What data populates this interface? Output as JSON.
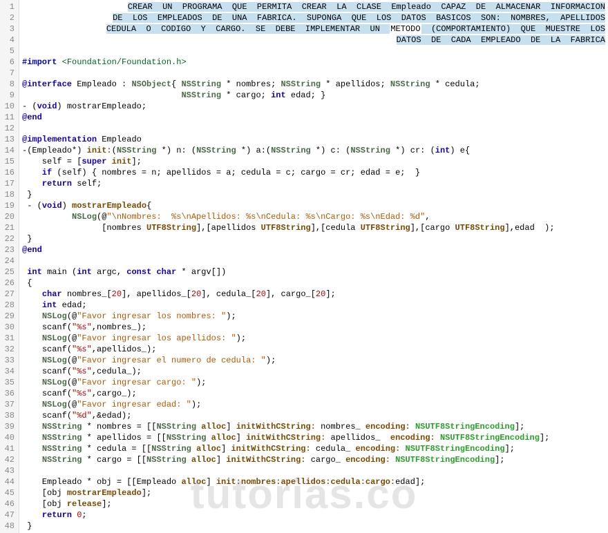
{
  "header": {
    "l1": "CREAR  UN  PROGRAMA  QUE  PERMITA  CREAR  LA  CLASE  Empleado  CAPAZ  DE  ALMACENAR  INFORMACION",
    "l2": "DE  LOS  EMPLEADOS  DE  UNA  FABRICA.  SUPONGA  QUE  LOS  DATOS  BASICOS  SON:  NOMBRES,  APELLIDOS",
    "l3_pre": "CEDULA  O  CODIGO  Y  CARGO.  SE  DEBE  IMPLEMENTAR  UN  ",
    "l3_word": "METODO",
    "l3_post": "  (COMPORTAMIENTO)  QUE  MUESTRE  LOS",
    "l4": "DATOS  DE  CADA  EMPLEADO  DE  LA  FABRICA"
  },
  "c": {
    "import": "#import",
    "incfile": "<Foundation/Foundation.h>",
    "interface": "@interface",
    "Empleado": " Empleado : ",
    "NSObject": "NSObject",
    "lb": "{ ",
    "NSString": "NSString",
    "star_nom": " * nombres; ",
    "star_ape": " * apellidos; ",
    "star_ced": " * cedula;",
    "star_car": " * cargo; ",
    "int": "int",
    "edad_cb": " edad; }",
    "dash": "- (",
    "void": "void",
    "mostrar_decl": ") mostrarEmpleado;",
    "atend": "@end",
    "impl": "@implementation",
    "imp_emp": " Empleado",
    "init_sig1": "-(Empleado*) ",
    "init": "init:",
    "p_n": "(",
    "ptrc": " *) ",
    "n_nm": "n",
    "colon": ": (",
    "a_nm": "a",
    "c_nm": "c",
    "cr_nm": "cr",
    "int_close": ") ",
    "e_ob": "e",
    "ob": "{",
    "self_super": "    self = [",
    "super": "super",
    "init_kw": " init",
    "rb_semi": "];",
    "if": "    if",
    "if_body": " (self) { nombres = n; apellidos = a; cedula = c; cargo = cr; edad = e;  }",
    "return": "    return",
    "self_semi": " self;",
    "rb": "}",
    "dash2": " - (",
    "mostrar_imp": ") ",
    "mostrarEmpleado": "mostrarEmpleado",
    "ob2": "{",
    "nslog": "NSLog",
    "at_open": "(@",
    "logstr": "\"\\nNombres:  %s\\nApellidos: %s\\nCedula: %s\\nCargo: %s\\nEdad: %d\"",
    "comma": ",",
    "nm_b": "[nombres ",
    "utf8": "UTF8String",
    "bC": "],",
    "ap_b": "[apellidos ",
    "cd_b": "[cedula ",
    "cg_b": "[cargo ",
    "edad_end": "edad  );",
    "main_sig1": " main (",
    "main_sig2": " argc, ",
    "const": "const",
    "char": " char",
    "argv": " * argv[])",
    "ob3": "{",
    "char_kw": "char",
    "nm_arr": " nombres_[",
    "twenty": "20",
    "rb_c": "], apellidos_[",
    "rb_c2": "], cedula_[",
    "rb_c3": "], cargo_[",
    "rb_semi2": "];",
    "int_edad": " edad;",
    "fav_nom": "\"Favor ingresar los nombres: \"",
    "close_p": ");",
    "scanf": "scanf",
    "op": "(",
    "fmt_s": "\"%s\"",
    "nm_ref": ",nombres_);",
    "fav_ape": "\"Favor ingresar los apellidos: \"",
    "ape_ref": ",apellidos_);",
    "fav_ced": "\"Favor ingresar el numero de cedula: \"",
    "ced_ref": ",cedula_);",
    "fav_car": "\"Favor ingresar cargo: \"",
    "car_ref": ",cargo_);",
    "fav_edad": "\"Favor ingresar edad: \"",
    "fmt_d": "\"%d\"",
    "edad_ref": ",&edad);",
    "star_nm_eq": " * nombres = [[",
    "alloc": "alloc",
    "rb_sp": "] ",
    "initC": "initWithCString:",
    "nm_u": " nombres_ ",
    "encoding": "encoding:",
    "sp": " ",
    "enc": "NSUTF8StringEncoding",
    "star_ape_eq": " * apellidos = [[",
    "ape_u": " apellidos_  ",
    "star_ced_eq": " * cedula = [[",
    "ced_u": " cedula_ ",
    "star_car_eq": " * cargo = [[",
    "car_u": " cargo_ ",
    "obj_line": "    Empleado * obj = [[Empleado ",
    "obj_rest": "init:nombres:apellidos:cedula:cargo:",
    "edad_b": "edad];",
    "obj_mostrar": "    [obj ",
    "release": "release",
    "return0": "    return",
    "zero": " 0",
    "semi": ";"
  },
  "watermark": "tutorias.co",
  "gutter_max": 48
}
